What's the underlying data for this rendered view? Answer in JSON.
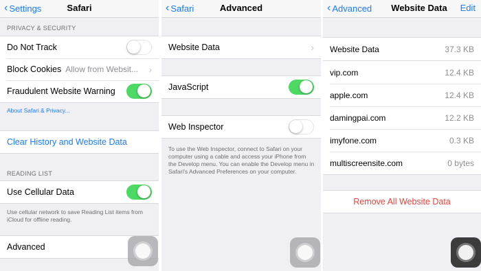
{
  "colors": {
    "accent": "#1a7cf5",
    "toggle_on": "#4cd964",
    "destructive": "#e5443c"
  },
  "safari": {
    "back_label": "Settings",
    "title": "Safari",
    "privacy_header": "PRIVACY & SECURITY",
    "do_not_track": {
      "label": "Do Not Track",
      "on": false
    },
    "block_cookies": {
      "label": "Block Cookies",
      "value": "Allow from Websit..."
    },
    "fraud_warning": {
      "label": "Fraudulent Website Warning",
      "on": true
    },
    "about_link": "About Safari & Privacy...",
    "clear_history": "Clear History and Website Data",
    "reading_header": "READING LIST",
    "cellular": {
      "label": "Use Cellular Data",
      "on": true
    },
    "cellular_footer": "Use cellular network to save Reading List items from iCloud for offline reading.",
    "advanced": "Advanced"
  },
  "advanced": {
    "back_label": "Safari",
    "title": "Advanced",
    "website_data": "Website Data",
    "javascript": {
      "label": "JavaScript",
      "on": true
    },
    "web_inspector": {
      "label": "Web Inspector",
      "on": false
    },
    "footer": "To use the Web Inspector, connect to Safari on your computer using a cable and access your iPhone from the Develop menu. You can enable the Develop menu in Safari's Advanced Preferences on your computer."
  },
  "website_data": {
    "back_label": "Advanced",
    "title": "Website Data",
    "edit_label": "Edit",
    "total_label": "Website Data",
    "total_size": "37.3 KB",
    "sites": [
      {
        "name": "vip.com",
        "size": "12.4 KB"
      },
      {
        "name": "apple.com",
        "size": "12.4 KB"
      },
      {
        "name": "damingpai.com",
        "size": "12.2 KB"
      },
      {
        "name": "imyfone.com",
        "size": "0.3 KB"
      },
      {
        "name": "multiscreensite.com",
        "size": "0 bytes"
      }
    ],
    "remove_all": "Remove All Website Data"
  }
}
